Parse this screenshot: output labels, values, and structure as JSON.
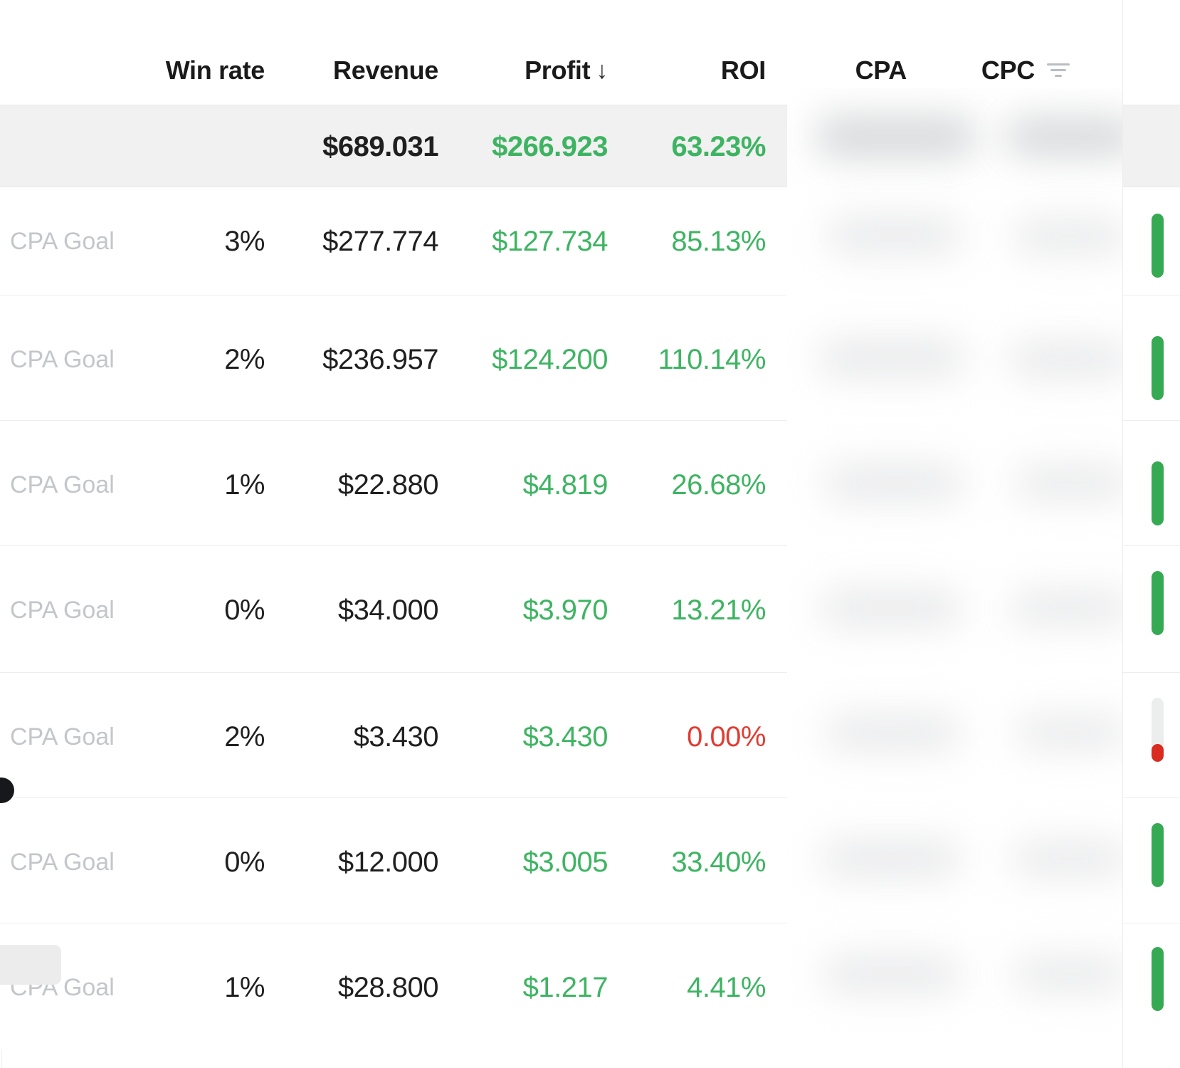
{
  "table": {
    "columns": [
      {
        "key": "goal",
        "label": "",
        "align": "left"
      },
      {
        "key": "win_rate",
        "label": "Win rate",
        "align": "right"
      },
      {
        "key": "revenue",
        "label": "Revenue",
        "align": "right"
      },
      {
        "key": "profit",
        "label": "Profit",
        "align": "right"
      },
      {
        "key": "roi",
        "label": "ROI",
        "align": "right"
      },
      {
        "key": "cpa",
        "label": "CPA",
        "align": "right"
      },
      {
        "key": "cpc",
        "label": "CPC",
        "align": "right"
      }
    ],
    "sort": {
      "column": "Profit",
      "direction": "descending",
      "glyph": "↓"
    },
    "filtered_column": "CPC",
    "icons": {
      "sort_indicator": "arrow-down-icon",
      "filter": "filter-icon"
    },
    "summary_row": {
      "goal": "",
      "win_rate": "",
      "revenue": "$689.031",
      "profit": "$266.923",
      "roi": "63.23%",
      "cpa": "",
      "cpc": "",
      "roi_state": "positive"
    },
    "rows": [
      {
        "goal": "CPA Goal",
        "win_rate": "3%",
        "revenue": "$277.774",
        "profit": "$127.734",
        "roi": "85.13%",
        "cpa": "",
        "cpc": "",
        "roi_state": "positive",
        "status": "ok",
        "status_fill_percent": 100
      },
      {
        "goal": "CPA Goal",
        "win_rate": "2%",
        "revenue": "$236.957",
        "profit": "$124.200",
        "roi": "110.14%",
        "cpa": "",
        "cpc": "",
        "roi_state": "positive",
        "status": "ok",
        "status_fill_percent": 100
      },
      {
        "goal": "CPA Goal",
        "win_rate": "1%",
        "revenue": "$22.880",
        "profit": "$4.819",
        "roi": "26.68%",
        "cpa": "",
        "cpc": "",
        "roi_state": "positive",
        "status": "ok",
        "status_fill_percent": 100
      },
      {
        "goal": "CPA Goal",
        "win_rate": "0%",
        "revenue": "$34.000",
        "profit": "$3.970",
        "roi": "13.21%",
        "cpa": "",
        "cpc": "",
        "roi_state": "positive",
        "status": "ok",
        "status_fill_percent": 100
      },
      {
        "goal": "CPA Goal",
        "win_rate": "2%",
        "revenue": "$3.430",
        "profit": "$3.430",
        "roi": "0.00%",
        "cpa": "",
        "cpc": "",
        "roi_state": "negative",
        "status": "bad",
        "status_fill_percent": 28
      },
      {
        "goal": "CPA Goal",
        "win_rate": "0%",
        "revenue": "$12.000",
        "profit": "$3.005",
        "roi": "33.40%",
        "cpa": "",
        "cpc": "",
        "roi_state": "positive",
        "status": "ok",
        "status_fill_percent": 100
      },
      {
        "goal": "CPA Goal",
        "win_rate": "1%",
        "revenue": "$28.800",
        "profit": "$1.217",
        "roi": "4.41%",
        "cpa": "",
        "cpc": "",
        "roi_state": "positive",
        "status": "ok",
        "status_fill_percent": 100
      }
    ]
  },
  "redaction": {
    "label": "blurred-columns-overlay",
    "columns_hidden": [
      "CPA",
      "CPC"
    ]
  },
  "colors": {
    "positive": "#3eb462",
    "negative": "#e23c32",
    "text": "#1f1f1f",
    "muted": "#c3c6ca",
    "summary_bg": "#f1f1f1",
    "divider": "#eceef0",
    "gauge_ok": "#36a953",
    "gauge_bad": "#d92b20",
    "gauge_track": "#eceded"
  }
}
